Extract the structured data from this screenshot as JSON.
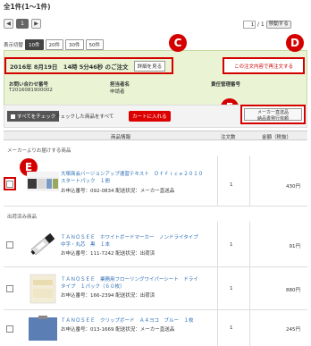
{
  "total": "全1件(1〜1件)",
  "pager": {
    "first": "◀",
    "current": "1",
    "next": "▶",
    "page_value": "1",
    "page_total": "/ 1",
    "go_label": "移動する"
  },
  "perpage": {
    "label": "表示切替",
    "options": [
      "10件",
      "20件",
      "30件",
      "50件"
    ]
  },
  "order": {
    "date": "2016年 8月19日　14時 5分46秒 のご注文",
    "detail_label": "詳細を見る",
    "reorder_label": "この注文内容で再注文する",
    "inquiry_label": "お問い合わせ番号",
    "inquiry_value": "T2016081900002",
    "person_label": "担当者名",
    "person_value": "申請者",
    "manager_label": "責任管理番号",
    "manager_value": ""
  },
  "callouts": {
    "c": "C",
    "d": "D",
    "e": "E",
    "f": "F"
  },
  "actions": {
    "check_all": "すべてをチェック",
    "checked_note": "チェックした商品をすべて",
    "cart": "カートに入れる",
    "bulk_line1": "メーカー直送品",
    "bulk_line2": "納品書発行依頼"
  },
  "table": {
    "col_product": "商品情報",
    "col_qty": "注文数",
    "col_amount": "金額（税抜）"
  },
  "sections": {
    "maker": "メーカーよりお届けする商品",
    "shipped": "出荷済み商品"
  },
  "items": [
    {
      "name_line1": "大塚商会バージョンアップ速習テキスト　Ｏｆｆｉｃｅ２０１０",
      "name_line2": "スタートパック　１冊",
      "order_no": "お申込番号：092-0834 配送状況：メーカー直送品",
      "qty": "1",
      "amount": "430円"
    },
    {
      "name_line1": "ＴＡＮＯＳＥＥ　ホワイトボードマーカー　ノンドライタイプ",
      "name_line2": "中字・丸芯　黒　１本",
      "order_no": "お申込番号：111-7242 配送状況：出荷済",
      "qty": "1",
      "amount": "91円"
    },
    {
      "name_line1": "ＴＡＮＯＳＥＥ　業務用フローリングワイパーシート　ドライ",
      "name_line2": "タイプ　１パック（６０枚）",
      "order_no": "お申込番号：166-2394 配送状況：出荷済",
      "qty": "1",
      "amount": "880円"
    },
    {
      "name_line1": "ＴＡＮＯＳＥＥ　クリップボード　Ａ４ヨコ　ブルー　１枚",
      "name_line2": "",
      "order_no": "お申込番号：013-1669 配送状況：メーカー直送品",
      "qty": "1",
      "amount": "245円"
    }
  ]
}
